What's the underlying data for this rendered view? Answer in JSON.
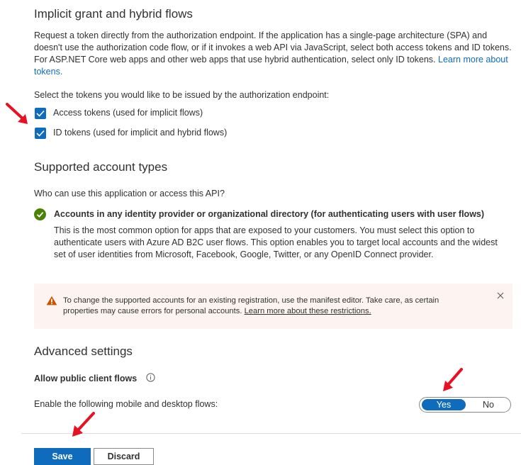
{
  "implicit": {
    "heading": "Implicit grant and hybrid flows",
    "desc_line1": "Request a token directly from the authorization endpoint. If the application has a single-page architecture (SPA) and",
    "desc_line2": "doesn't use the authorization code flow, or if it invokes a web API via JavaScript, select both access tokens and ID tokens.",
    "desc_line3": "For ASP.NET Core web apps and other web apps that use hybrid authentication, select only ID tokens.",
    "learn_more": "Learn more about",
    "learn_more_cont": "tokens.",
    "select_prompt": "Select the tokens you would like to be issued by the authorization endpoint:",
    "access_tokens_label": "Access tokens (used for implicit flows)",
    "access_tokens_checked": true,
    "id_tokens_label": "ID tokens (used for implicit and hybrid flows)",
    "id_tokens_checked": true
  },
  "accounts": {
    "heading": "Supported account types",
    "question": "Who can use this application or access this API?",
    "option_title": "Accounts in any identity provider or organizational directory (for authenticating users with user flows)",
    "option_line1": "This is the most common option for apps that are exposed to your customers. You must select this option to",
    "option_line2": "authenticate users with Azure AD B2C user flows. This option enables you to target local accounts and the widest",
    "option_line3": "set of user identities from Microsoft, Facebook, Google, Twitter, or any OpenID Connect provider."
  },
  "warning": {
    "line1": "To change the supported accounts for an existing registration, use the manifest editor. Take care, as certain",
    "line2": "properties may cause errors for personal accounts.",
    "link": "Learn more about these restrictions."
  },
  "advanced": {
    "heading": "Advanced settings",
    "public_client_label": "Allow public client flows",
    "flows_label": "Enable the following mobile and desktop flows:",
    "toggle_yes": "Yes",
    "toggle_no": "No",
    "toggle_value": "Yes"
  },
  "footer": {
    "save": "Save",
    "discard": "Discard"
  },
  "colors": {
    "accent": "#0f6cbd",
    "success": "#498205",
    "warning_icon": "#c75600",
    "annotation_arrow": "#e81123"
  }
}
